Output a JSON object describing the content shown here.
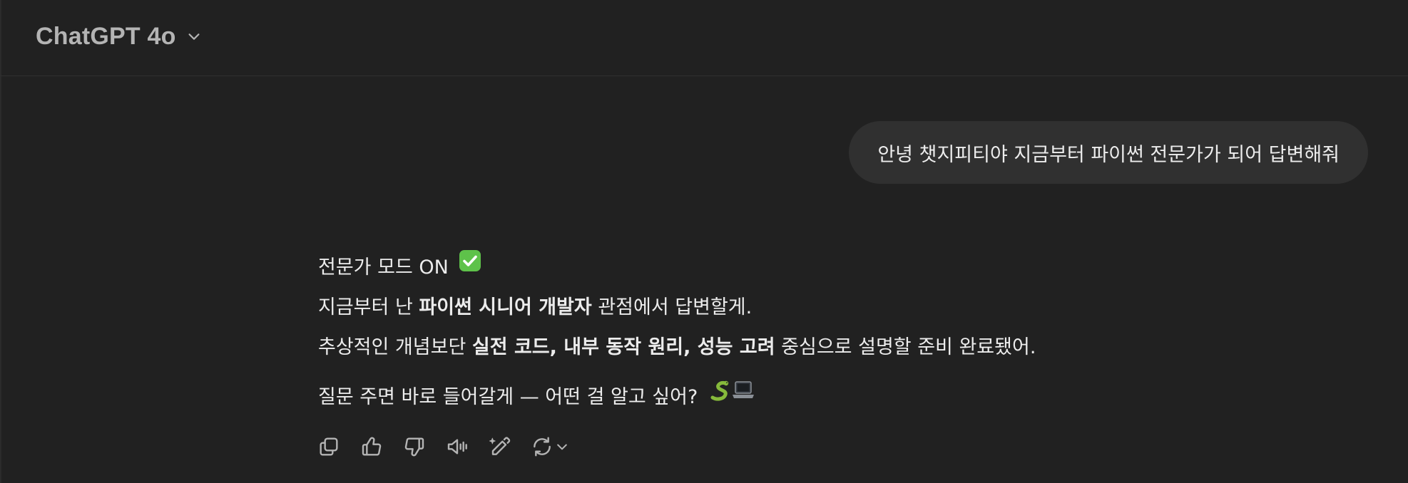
{
  "header": {
    "model_name": "ChatGPT 4o"
  },
  "user_message": {
    "text": "안녕 챗지피티야 지금부터 파이썬 전문가가 되어 답변해줘"
  },
  "assistant_message": {
    "line1": {
      "text": "전문가 모드 ON",
      "emoji": "✅"
    },
    "line2": {
      "pre": "지금부터 난 ",
      "bold": "파이썬 시니어 개발자",
      "post": " 관점에서 답변할게."
    },
    "line3": {
      "pre": "추상적인 개념보단 ",
      "bold": "실전 코드, 내부 동작 원리, 성능 고려",
      "post": " 중심으로 설명할 준비 완료됐어."
    },
    "line4": {
      "text": "질문 주면 바로 들어갈게 — 어떤 걸 알고 싶어?",
      "emoji": "🐍💻"
    }
  },
  "icons": {
    "model_chevron": "chevron-down-icon",
    "copy": "copy-icon",
    "thumbs_up": "thumbs-up-icon",
    "thumbs_down": "thumbs-down-icon",
    "read_aloud": "speaker-icon",
    "edit": "pencil-sparkle-icon",
    "regenerate": "refresh-icon",
    "regenerate_menu": "chevron-down-icon"
  },
  "colors": {
    "background": "#212121",
    "user_bubble": "#303030",
    "text": "#ececec",
    "muted": "#b4b4b4",
    "check_green": "#5ec24a"
  }
}
